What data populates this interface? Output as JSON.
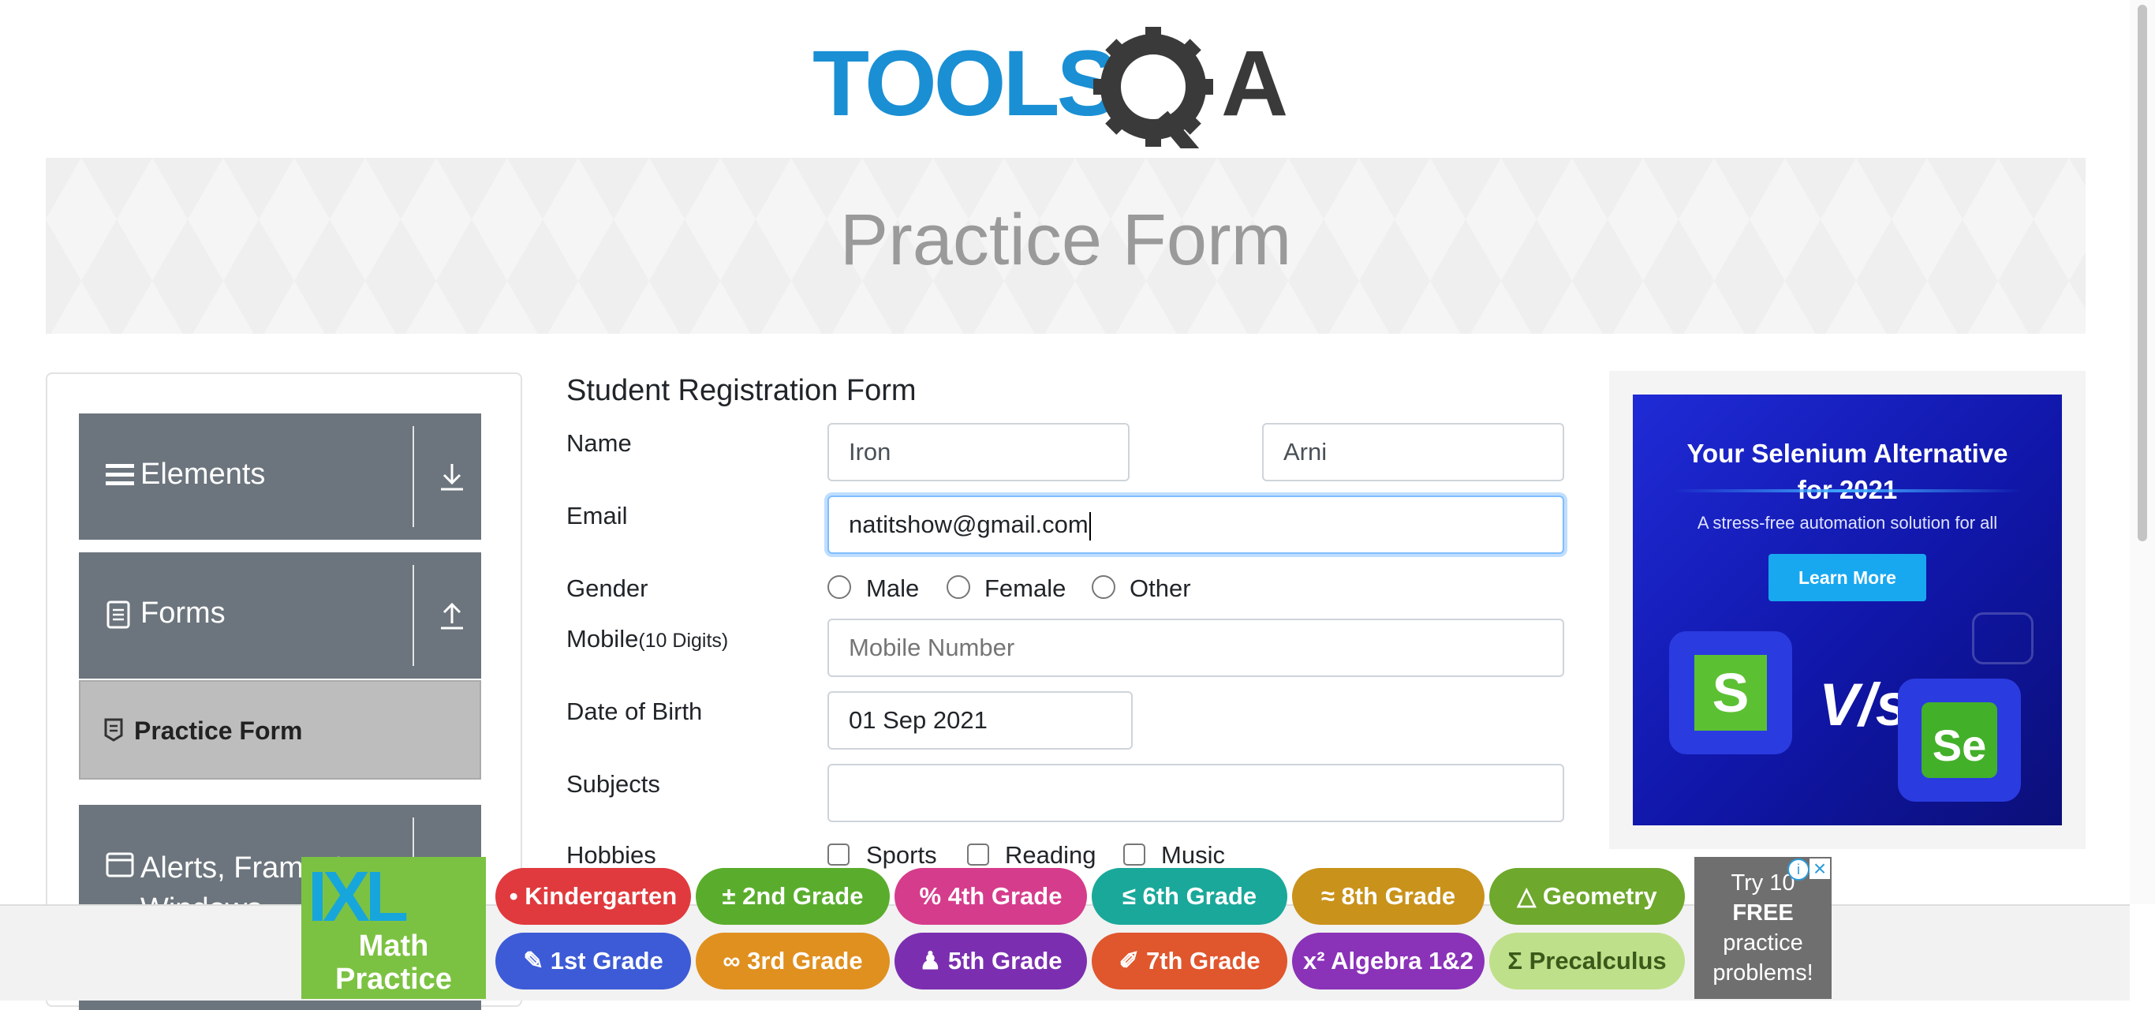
{
  "header": {
    "logo_text_left": "TOOLS",
    "logo_text_right": "A"
  },
  "banner": {
    "title": "Practice Form"
  },
  "sidebar": {
    "groups": [
      {
        "label": "Elements",
        "icon": "menu-icon",
        "toggle": "download-icon"
      },
      {
        "label": "Forms",
        "icon": "document-icon",
        "toggle": "upload-icon"
      },
      {
        "label": "Alerts, Frame & Windows",
        "icon": "window-icon",
        "toggle": "chevron-icon"
      }
    ],
    "active_item": {
      "label": "Practice Form",
      "icon": "form-icon"
    }
  },
  "form": {
    "title": "Student Registration Form",
    "name_label": "Name",
    "first_name": "Iron",
    "last_name": "Arni",
    "email_label": "Email",
    "email_value": "natitshow@gmail.com",
    "gender_label": "Gender",
    "gender_options": [
      "Male",
      "Female",
      "Other"
    ],
    "mobile_label": "Mobile",
    "mobile_hint": "(10 Digits)",
    "mobile_placeholder": "Mobile Number",
    "dob_label": "Date of Birth",
    "dob_value": "01 Sep 2021",
    "subjects_label": "Subjects",
    "hobbies_label": "Hobbies",
    "hobby_options": [
      "Sports",
      "Reading",
      "Music"
    ]
  },
  "ad": {
    "title_line1": "Your Selenium Alternative",
    "title_line2": "for 2021",
    "subtitle": "A stress-free automation solution for all",
    "button": "Learn More",
    "vs_text": "V/s",
    "left_logo": "S",
    "right_logo": "Se"
  },
  "bottom_ad": {
    "brand": "IXL",
    "brand_sub1": "Math",
    "brand_sub2": "Practice",
    "grades_row1": [
      "Kindergarten",
      "2nd Grade",
      "4th Grade",
      "6th Grade",
      "8th Grade",
      "Geometry"
    ],
    "grades_row2": [
      "1st Grade",
      "3rd Grade",
      "5th Grade",
      "7th Grade",
      "Algebra 1&2",
      "Precalculus"
    ],
    "row1_prefix": [
      "•",
      "±",
      "%",
      "≤",
      "≈",
      "△"
    ],
    "row2_prefix": [
      "✎",
      "∞",
      "♟",
      "✐",
      "x²",
      "Σ"
    ],
    "row1_colors": [
      "#e03a3e",
      "#5aad2c",
      "#d63c8c",
      "#1aa89a",
      "#c9921a",
      "#6ea82c"
    ],
    "row2_colors": [
      "#3d5bd6",
      "#e0901f",
      "#7b2fb0",
      "#e0562d",
      "#8a32b8",
      "#bfe08a"
    ],
    "try_lines": [
      "Try 10",
      "FREE",
      "practice",
      "problems!"
    ]
  }
}
